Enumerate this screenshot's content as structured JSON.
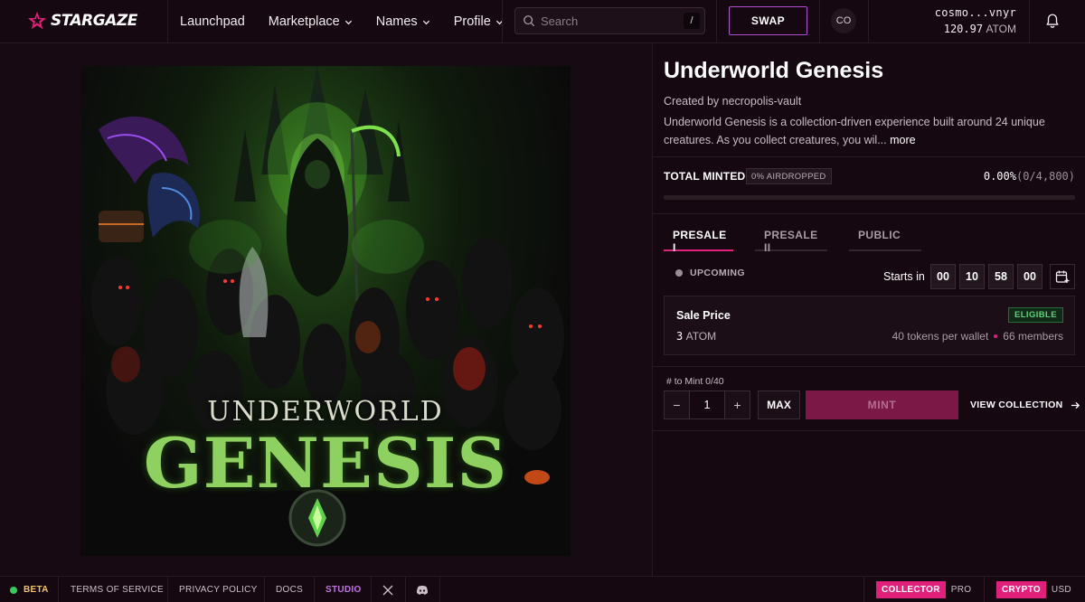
{
  "header": {
    "brand": "STARGAZE",
    "nav": [
      {
        "label": "Launchpad",
        "dropdown": false
      },
      {
        "label": "Marketplace",
        "dropdown": true
      },
      {
        "label": "Names",
        "dropdown": true
      },
      {
        "label": "Profile",
        "dropdown": true
      }
    ],
    "search_placeholder": "Search",
    "search_shortcut": "/",
    "swap_label": "SWAP",
    "avatar_initials": "CO",
    "wallet_address": "cosmo...vnyr",
    "wallet_balance": "120.97",
    "wallet_unit": "ATOM"
  },
  "artwork": {
    "title_line1": "UNDERWORLD",
    "title_line2": "GENESIS"
  },
  "collection": {
    "title": "Underworld Genesis",
    "created_by": "Created by necropolis-vault",
    "description": "Underworld Genesis is a collection-driven experience built around 24 unique creatures. As you collect creatures, you wil...",
    "more_label": "more"
  },
  "minted": {
    "label": "TOTAL MINTED",
    "airdrop_badge": "0% AIRDROPPED",
    "percent": "0.00%",
    "count": "(0/4,800)",
    "progress": 0
  },
  "tabs": [
    {
      "label": "PRESALE I",
      "active": true
    },
    {
      "label": "PRESALE II",
      "active": false
    },
    {
      "label": "PUBLIC",
      "active": false
    }
  ],
  "phase": {
    "status": "UPCOMING",
    "starts_label": "Starts in",
    "countdown": [
      "00",
      "10",
      "58",
      "00"
    ]
  },
  "sale": {
    "label": "Sale Price",
    "price": "3",
    "unit": "ATOM",
    "eligibility": "ELIGIBLE",
    "per_wallet": "40 tokens per wallet",
    "members": "66 members"
  },
  "mint": {
    "to_mint_label": "# to Mint 0/40",
    "minus": "−",
    "quantity": "1",
    "plus": "+",
    "max_label": "MAX",
    "mint_label": "MINT",
    "view_collection": "VIEW COLLECTION"
  },
  "footer": {
    "beta": "BETA",
    "terms": "TERMS OF SERVICE",
    "privacy": "PRIVACY POLICY",
    "docs": "DOCS",
    "studio": "STUDIO",
    "mode_on": "COLLECTOR",
    "mode_off": "PRO",
    "currency_on": "CRYPTO",
    "currency_off": "USD"
  },
  "colors": {
    "accent": "#e0207b",
    "swap_border": "#b14dcf",
    "eligible": "#5ed27a",
    "beta": "#f2c36b",
    "studio": "#c270e6"
  }
}
